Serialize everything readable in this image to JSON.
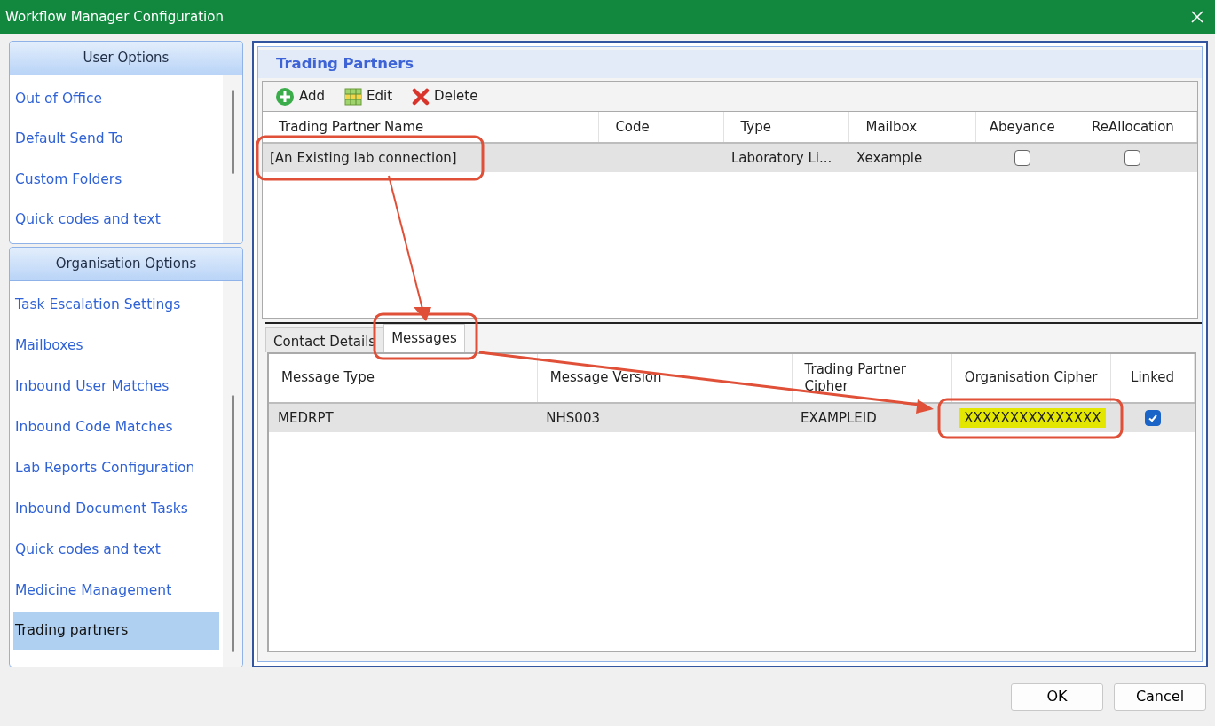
{
  "window": {
    "title": "Workflow Manager Configuration"
  },
  "sidebar": [
    {
      "title": "User Options",
      "items": [
        {
          "label": "Out of Office",
          "selected": false
        },
        {
          "label": "Default Send To",
          "selected": false
        },
        {
          "label": "Custom Folders",
          "selected": false
        },
        {
          "label": "Quick codes and text",
          "selected": false
        }
      ]
    },
    {
      "title": "Organisation Options",
      "items": [
        {
          "label": "Task Escalation Settings",
          "selected": false
        },
        {
          "label": "Mailboxes",
          "selected": false
        },
        {
          "label": "Inbound User Matches",
          "selected": false
        },
        {
          "label": "Inbound Code Matches",
          "selected": false
        },
        {
          "label": "Lab Reports Configuration",
          "selected": false
        },
        {
          "label": "Inbound Document Tasks",
          "selected": false
        },
        {
          "label": "Quick codes and text",
          "selected": false
        },
        {
          "label": "Medicine Management",
          "selected": false
        },
        {
          "label": "Trading partners",
          "selected": true
        }
      ]
    }
  ],
  "panel": {
    "title": "Trading Partners"
  },
  "toolbar": [
    {
      "label": "Add",
      "kind": "add"
    },
    {
      "label": "Edit",
      "kind": "edit"
    },
    {
      "label": "Delete",
      "kind": "delete"
    }
  ],
  "partners_table": {
    "columns": [
      "Trading Partner Name",
      "Code",
      "Type",
      "Mailbox",
      "Abeyance",
      "ReAllocation"
    ],
    "rows": [
      {
        "name": "[An Existing lab connection]",
        "type": "Laboratory Li...",
        "mailbox": "Xexample",
        "abeyance": false,
        "reallocation": false,
        "selected": true
      }
    ]
  },
  "detail_tabs": [
    {
      "label": "Contact Details",
      "selected": false
    },
    {
      "label": "Messages",
      "selected": true
    }
  ],
  "messages_table": {
    "columns": [
      "Message Type",
      "Message Version",
      "Trading Partner Cipher",
      "Organisation Cipher",
      "Linked"
    ],
    "rows": [
      {
        "message_type": "MEDRPT",
        "message_version": "NHS003",
        "partner_cipher": "EXAMPLEID",
        "organisation_cipher": "XXXXXXXXXXXXXXX",
        "cipher_highlighted": true,
        "linked": true,
        "selected": true
      }
    ]
  },
  "buttons": [
    {
      "label": "OK"
    },
    {
      "label": "Cancel"
    }
  ]
}
